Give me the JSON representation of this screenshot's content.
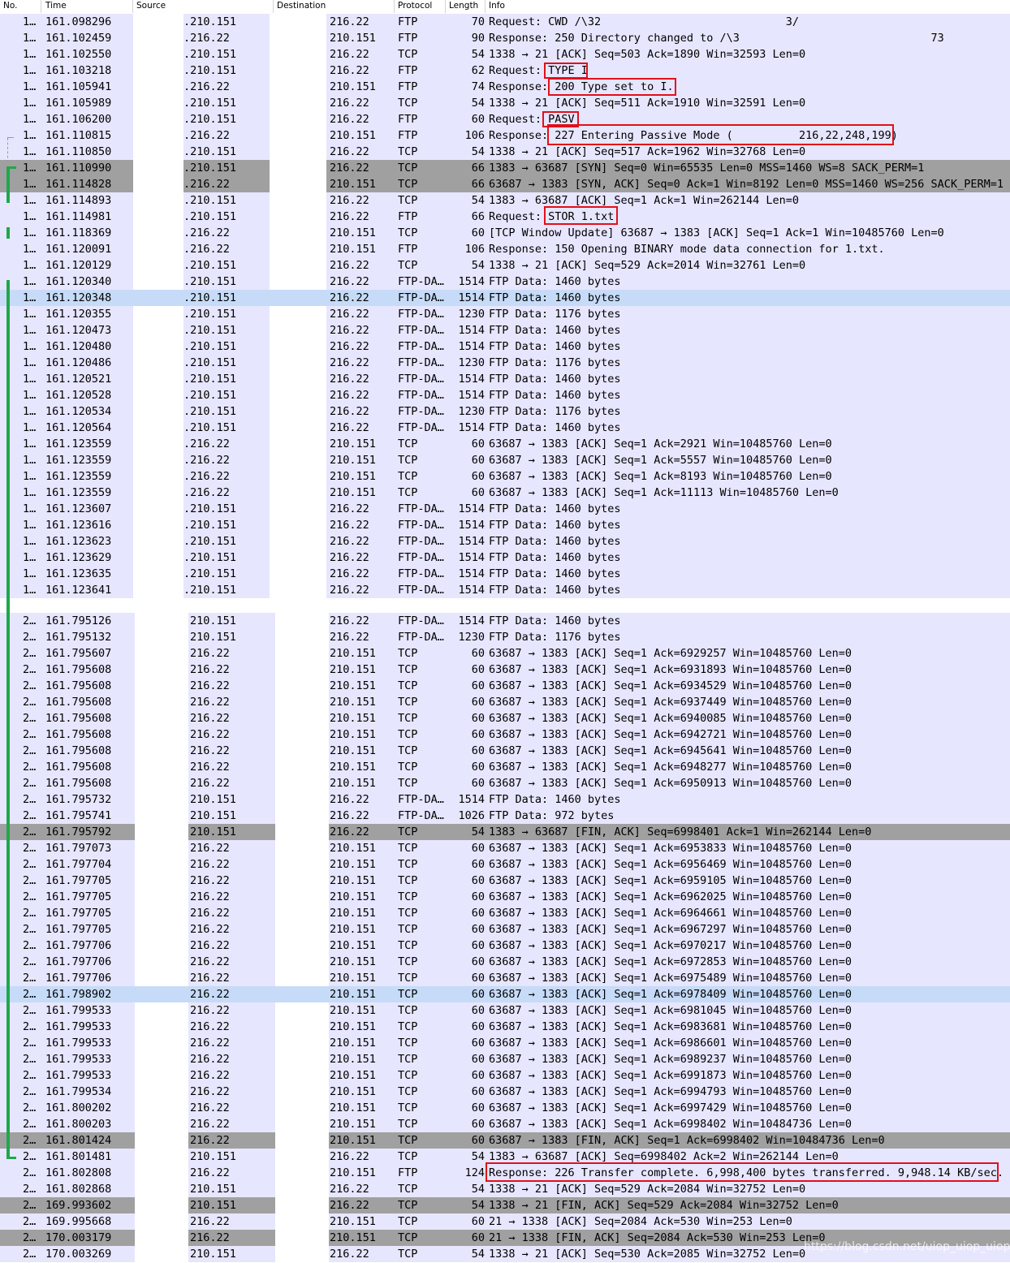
{
  "columns": {
    "no": "No.",
    "time": "Time",
    "source": "Source",
    "destination": "Destination",
    "protocol": "Protocol",
    "length": "Length",
    "info": "Info"
  },
  "colors": {
    "tcp_ftp_bg": "#e7e6ff",
    "selected_bg": "#c6dbf7",
    "fin_bg": "#a0a0a0",
    "white": "#ffffff",
    "highlight_border": "#e0101a",
    "conversation_bracket": "#1fa84a"
  },
  "packets_part1": [
    {
      "no": "1…",
      "time": "161.098296",
      "src": ".210.151",
      "dst": "216.22",
      "proto": "FTP",
      "len": "70",
      "info": "Request: CWD /\\32                            3/",
      "style": "n"
    },
    {
      "no": "1…",
      "time": "161.102459",
      "src": ".216.22",
      "dst": "210.151",
      "proto": "FTP",
      "len": "90",
      "info": "Response: 250 Directory changed to /\\3                             73",
      "style": "n"
    },
    {
      "no": "1…",
      "time": "161.102550",
      "src": ".210.151",
      "dst": "216.22",
      "proto": "TCP",
      "len": "54",
      "info": "1338 → 21 [ACK] Seq=503 Ack=1890 Win=32593 Len=0",
      "style": "n"
    },
    {
      "no": "1…",
      "time": "161.103218",
      "src": ".210.151",
      "dst": "216.22",
      "proto": "FTP",
      "len": "62",
      "info": "Request: TYPE I",
      "style": "n"
    },
    {
      "no": "1…",
      "time": "161.105941",
      "src": ".216.22",
      "dst": "210.151",
      "proto": "FTP",
      "len": "74",
      "info": "Response: 200 Type set to I.",
      "style": "n"
    },
    {
      "no": "1…",
      "time": "161.105989",
      "src": ".210.151",
      "dst": "216.22",
      "proto": "TCP",
      "len": "54",
      "info": "1338 → 21 [ACK] Seq=511 Ack=1910 Win=32591 Len=0",
      "style": "n"
    },
    {
      "no": "1…",
      "time": "161.106200",
      "src": ".210.151",
      "dst": "216.22",
      "proto": "FTP",
      "len": "60",
      "info": "Request: PASV",
      "style": "n"
    },
    {
      "no": "1…",
      "time": "161.110815",
      "src": ".216.22",
      "dst": "210.151",
      "proto": "FTP",
      "len": "106",
      "info": "Response: 227 Entering Passive Mode (          216,22,248,199)",
      "style": "n"
    },
    {
      "no": "1…",
      "time": "161.110850",
      "src": ".210.151",
      "dst": "216.22",
      "proto": "TCP",
      "len": "54",
      "info": "1338 → 21 [ACK] Seq=517 Ack=1962 Win=32768 Len=0",
      "style": "n"
    },
    {
      "no": "1…",
      "time": "161.110990",
      "src": ".210.151",
      "dst": "216.22",
      "proto": "TCP",
      "len": "66",
      "info": "1383 → 63687 [SYN] Seq=0 Win=65535 Len=0 MSS=1460 WS=8 SACK_PERM=1",
      "style": "g"
    },
    {
      "no": "1…",
      "time": "161.114828",
      "src": ".216.22",
      "dst": "210.151",
      "proto": "TCP",
      "len": "66",
      "info": "63687 → 1383 [SYN, ACK] Seq=0 Ack=1 Win=8192 Len=0 MSS=1460 WS=256 SACK_PERM=1",
      "style": "g"
    },
    {
      "no": "1…",
      "time": "161.114893",
      "src": ".210.151",
      "dst": "216.22",
      "proto": "TCP",
      "len": "54",
      "info": "1383 → 63687 [ACK] Seq=1 Ack=1 Win=262144 Len=0",
      "style": "n"
    },
    {
      "no": "1…",
      "time": "161.114981",
      "src": ".210.151",
      "dst": "216.22",
      "proto": "FTP",
      "len": "66",
      "info": "Request: STOR 1.txt",
      "style": "n"
    },
    {
      "no": "1…",
      "time": "161.118369",
      "src": ".216.22",
      "dst": "210.151",
      "proto": "TCP",
      "len": "60",
      "info": "[TCP Window Update] 63687 → 1383 [ACK] Seq=1 Ack=1 Win=10485760 Len=0",
      "style": "n"
    },
    {
      "no": "1…",
      "time": "161.120091",
      "src": ".216.22",
      "dst": "210.151",
      "proto": "FTP",
      "len": "106",
      "info": "Response: 150 Opening BINARY mode data connection for 1.txt.",
      "style": "n"
    },
    {
      "no": "1…",
      "time": "161.120129",
      "src": ".210.151",
      "dst": "216.22",
      "proto": "TCP",
      "len": "54",
      "info": "1338 → 21 [ACK] Seq=529 Ack=2014 Win=32761 Len=0",
      "style": "n"
    },
    {
      "no": "1…",
      "time": "161.120340",
      "src": ".210.151",
      "dst": "216.22",
      "proto": "FTP-DA…",
      "len": "1514",
      "info": "FTP Data: 1460 bytes",
      "style": "n"
    },
    {
      "no": "1…",
      "time": "161.120348",
      "src": ".210.151",
      "dst": "216.22",
      "proto": "FTP-DA…",
      "len": "1514",
      "info": "FTP Data: 1460 bytes",
      "style": "s"
    },
    {
      "no": "1…",
      "time": "161.120355",
      "src": ".210.151",
      "dst": "216.22",
      "proto": "FTP-DA…",
      "len": "1230",
      "info": "FTP Data: 1176 bytes",
      "style": "n"
    },
    {
      "no": "1…",
      "time": "161.120473",
      "src": ".210.151",
      "dst": "216.22",
      "proto": "FTP-DA…",
      "len": "1514",
      "info": "FTP Data: 1460 bytes",
      "style": "n"
    },
    {
      "no": "1…",
      "time": "161.120480",
      "src": ".210.151",
      "dst": "216.22",
      "proto": "FTP-DA…",
      "len": "1514",
      "info": "FTP Data: 1460 bytes",
      "style": "n"
    },
    {
      "no": "1…",
      "time": "161.120486",
      "src": ".210.151",
      "dst": "216.22",
      "proto": "FTP-DA…",
      "len": "1230",
      "info": "FTP Data: 1176 bytes",
      "style": "n"
    },
    {
      "no": "1…",
      "time": "161.120521",
      "src": ".210.151",
      "dst": "216.22",
      "proto": "FTP-DA…",
      "len": "1514",
      "info": "FTP Data: 1460 bytes",
      "style": "n"
    },
    {
      "no": "1…",
      "time": "161.120528",
      "src": ".210.151",
      "dst": "216.22",
      "proto": "FTP-DA…",
      "len": "1514",
      "info": "FTP Data: 1460 bytes",
      "style": "n"
    },
    {
      "no": "1…",
      "time": "161.120534",
      "src": ".210.151",
      "dst": "216.22",
      "proto": "FTP-DA…",
      "len": "1230",
      "info": "FTP Data: 1176 bytes",
      "style": "n"
    },
    {
      "no": "1…",
      "time": "161.120564",
      "src": ".210.151",
      "dst": "216.22",
      "proto": "FTP-DA…",
      "len": "1514",
      "info": "FTP Data: 1460 bytes",
      "style": "n"
    },
    {
      "no": "1…",
      "time": "161.123559",
      "src": ".216.22",
      "dst": "210.151",
      "proto": "TCP",
      "len": "60",
      "info": "63687 → 1383 [ACK] Seq=1 Ack=2921 Win=10485760 Len=0",
      "style": "n"
    },
    {
      "no": "1…",
      "time": "161.123559",
      "src": ".216.22",
      "dst": "210.151",
      "proto": "TCP",
      "len": "60",
      "info": "63687 → 1383 [ACK] Seq=1 Ack=5557 Win=10485760 Len=0",
      "style": "n"
    },
    {
      "no": "1…",
      "time": "161.123559",
      "src": ".216.22",
      "dst": "210.151",
      "proto": "TCP",
      "len": "60",
      "info": "63687 → 1383 [ACK] Seq=1 Ack=8193 Win=10485760 Len=0",
      "style": "n"
    },
    {
      "no": "1…",
      "time": "161.123559",
      "src": ".216.22",
      "dst": "210.151",
      "proto": "TCP",
      "len": "60",
      "info": "63687 → 1383 [ACK] Seq=1 Ack=11113 Win=10485760 Len=0",
      "style": "n"
    },
    {
      "no": "1…",
      "time": "161.123607",
      "src": ".210.151",
      "dst": "216.22",
      "proto": "FTP-DA…",
      "len": "1514",
      "info": "FTP Data: 1460 bytes",
      "style": "n"
    },
    {
      "no": "1…",
      "time": "161.123616",
      "src": ".210.151",
      "dst": "216.22",
      "proto": "FTP-DA…",
      "len": "1514",
      "info": "FTP Data: 1460 bytes",
      "style": "n"
    },
    {
      "no": "1…",
      "time": "161.123623",
      "src": ".210.151",
      "dst": "216.22",
      "proto": "FTP-DA…",
      "len": "1514",
      "info": "FTP Data: 1460 bytes",
      "style": "n"
    },
    {
      "no": "1…",
      "time": "161.123629",
      "src": ".210.151",
      "dst": "216.22",
      "proto": "FTP-DA…",
      "len": "1514",
      "info": "FTP Data: 1460 bytes",
      "style": "n"
    },
    {
      "no": "1…",
      "time": "161.123635",
      "src": ".210.151",
      "dst": "216.22",
      "proto": "FTP-DA…",
      "len": "1514",
      "info": "FTP Data: 1460 bytes",
      "style": "n"
    },
    {
      "no": "1…",
      "time": "161.123641",
      "src": ".210.151",
      "dst": "216.22",
      "proto": "FTP-DA…",
      "len": "1514",
      "info": "FTP Data: 1460 bytes",
      "style": "n"
    }
  ],
  "packets_part2": [
    {
      "no": "2…",
      "time": "161.795126",
      "src": "210.151",
      "dst": "216.22",
      "proto": "FTP-DA…",
      "len": "1514",
      "info": "FTP Data: 1460 bytes",
      "style": "n"
    },
    {
      "no": "2…",
      "time": "161.795132",
      "src": "210.151",
      "dst": "216.22",
      "proto": "FTP-DA…",
      "len": "1230",
      "info": "FTP Data: 1176 bytes",
      "style": "n"
    },
    {
      "no": "2…",
      "time": "161.795607",
      "src": "216.22",
      "dst": "210.151",
      "proto": "TCP",
      "len": "60",
      "info": "63687 → 1383 [ACK] Seq=1 Ack=6929257 Win=10485760 Len=0",
      "style": "n"
    },
    {
      "no": "2…",
      "time": "161.795608",
      "src": "216.22",
      "dst": "210.151",
      "proto": "TCP",
      "len": "60",
      "info": "63687 → 1383 [ACK] Seq=1 Ack=6931893 Win=10485760 Len=0",
      "style": "n"
    },
    {
      "no": "2…",
      "time": "161.795608",
      "src": "216.22",
      "dst": "210.151",
      "proto": "TCP",
      "len": "60",
      "info": "63687 → 1383 [ACK] Seq=1 Ack=6934529 Win=10485760 Len=0",
      "style": "n"
    },
    {
      "no": "2…",
      "time": "161.795608",
      "src": "216.22",
      "dst": "210.151",
      "proto": "TCP",
      "len": "60",
      "info": "63687 → 1383 [ACK] Seq=1 Ack=6937449 Win=10485760 Len=0",
      "style": "n"
    },
    {
      "no": "2…",
      "time": "161.795608",
      "src": "216.22",
      "dst": "210.151",
      "proto": "TCP",
      "len": "60",
      "info": "63687 → 1383 [ACK] Seq=1 Ack=6940085 Win=10485760 Len=0",
      "style": "n"
    },
    {
      "no": "2…",
      "time": "161.795608",
      "src": "216.22",
      "dst": "210.151",
      "proto": "TCP",
      "len": "60",
      "info": "63687 → 1383 [ACK] Seq=1 Ack=6942721 Win=10485760 Len=0",
      "style": "n"
    },
    {
      "no": "2…",
      "time": "161.795608",
      "src": "216.22",
      "dst": "210.151",
      "proto": "TCP",
      "len": "60",
      "info": "63687 → 1383 [ACK] Seq=1 Ack=6945641 Win=10485760 Len=0",
      "style": "n"
    },
    {
      "no": "2…",
      "time": "161.795608",
      "src": "216.22",
      "dst": "210.151",
      "proto": "TCP",
      "len": "60",
      "info": "63687 → 1383 [ACK] Seq=1 Ack=6948277 Win=10485760 Len=0",
      "style": "n"
    },
    {
      "no": "2…",
      "time": "161.795608",
      "src": "216.22",
      "dst": "210.151",
      "proto": "TCP",
      "len": "60",
      "info": "63687 → 1383 [ACK] Seq=1 Ack=6950913 Win=10485760 Len=0",
      "style": "n"
    },
    {
      "no": "2…",
      "time": "161.795732",
      "src": "210.151",
      "dst": "216.22",
      "proto": "FTP-DA…",
      "len": "1514",
      "info": "FTP Data: 1460 bytes",
      "style": "n"
    },
    {
      "no": "2…",
      "time": "161.795741",
      "src": "210.151",
      "dst": "216.22",
      "proto": "FTP-DA…",
      "len": "1026",
      "info": "FTP Data: 972 bytes",
      "style": "n"
    },
    {
      "no": "2…",
      "time": "161.795792",
      "src": "210.151",
      "dst": "216.22",
      "proto": "TCP",
      "len": "54",
      "info": "1383 → 63687 [FIN, ACK] Seq=6998401 Ack=1 Win=262144 Len=0",
      "style": "g"
    },
    {
      "no": "2…",
      "time": "161.797073",
      "src": "216.22",
      "dst": "210.151",
      "proto": "TCP",
      "len": "60",
      "info": "63687 → 1383 [ACK] Seq=1 Ack=6953833 Win=10485760 Len=0",
      "style": "n"
    },
    {
      "no": "2…",
      "time": "161.797704",
      "src": "216.22",
      "dst": "210.151",
      "proto": "TCP",
      "len": "60",
      "info": "63687 → 1383 [ACK] Seq=1 Ack=6956469 Win=10485760 Len=0",
      "style": "n"
    },
    {
      "no": "2…",
      "time": "161.797705",
      "src": "216.22",
      "dst": "210.151",
      "proto": "TCP",
      "len": "60",
      "info": "63687 → 1383 [ACK] Seq=1 Ack=6959105 Win=10485760 Len=0",
      "style": "n"
    },
    {
      "no": "2…",
      "time": "161.797705",
      "src": "216.22",
      "dst": "210.151",
      "proto": "TCP",
      "len": "60",
      "info": "63687 → 1383 [ACK] Seq=1 Ack=6962025 Win=10485760 Len=0",
      "style": "n"
    },
    {
      "no": "2…",
      "time": "161.797705",
      "src": "216.22",
      "dst": "210.151",
      "proto": "TCP",
      "len": "60",
      "info": "63687 → 1383 [ACK] Seq=1 Ack=6964661 Win=10485760 Len=0",
      "style": "n"
    },
    {
      "no": "2…",
      "time": "161.797705",
      "src": "216.22",
      "dst": "210.151",
      "proto": "TCP",
      "len": "60",
      "info": "63687 → 1383 [ACK] Seq=1 Ack=6967297 Win=10485760 Len=0",
      "style": "n"
    },
    {
      "no": "2…",
      "time": "161.797706",
      "src": "216.22",
      "dst": "210.151",
      "proto": "TCP",
      "len": "60",
      "info": "63687 → 1383 [ACK] Seq=1 Ack=6970217 Win=10485760 Len=0",
      "style": "n"
    },
    {
      "no": "2…",
      "time": "161.797706",
      "src": "216.22",
      "dst": "210.151",
      "proto": "TCP",
      "len": "60",
      "info": "63687 → 1383 [ACK] Seq=1 Ack=6972853 Win=10485760 Len=0",
      "style": "n"
    },
    {
      "no": "2…",
      "time": "161.797706",
      "src": "216.22",
      "dst": "210.151",
      "proto": "TCP",
      "len": "60",
      "info": "63687 → 1383 [ACK] Seq=1 Ack=6975489 Win=10485760 Len=0",
      "style": "n"
    },
    {
      "no": "2…",
      "time": "161.798902",
      "src": "216.22",
      "dst": "210.151",
      "proto": "TCP",
      "len": "60",
      "info": "63687 → 1383 [ACK] Seq=1 Ack=6978409 Win=10485760 Len=0",
      "style": "s"
    },
    {
      "no": "2…",
      "time": "161.799533",
      "src": "216.22",
      "dst": "210.151",
      "proto": "TCP",
      "len": "60",
      "info": "63687 → 1383 [ACK] Seq=1 Ack=6981045 Win=10485760 Len=0",
      "style": "n"
    },
    {
      "no": "2…",
      "time": "161.799533",
      "src": "216.22",
      "dst": "210.151",
      "proto": "TCP",
      "len": "60",
      "info": "63687 → 1383 [ACK] Seq=1 Ack=6983681 Win=10485760 Len=0",
      "style": "n"
    },
    {
      "no": "2…",
      "time": "161.799533",
      "src": "216.22",
      "dst": "210.151",
      "proto": "TCP",
      "len": "60",
      "info": "63687 → 1383 [ACK] Seq=1 Ack=6986601 Win=10485760 Len=0",
      "style": "n"
    },
    {
      "no": "2…",
      "time": "161.799533",
      "src": "216.22",
      "dst": "210.151",
      "proto": "TCP",
      "len": "60",
      "info": "63687 → 1383 [ACK] Seq=1 Ack=6989237 Win=10485760 Len=0",
      "style": "n"
    },
    {
      "no": "2…",
      "time": "161.799533",
      "src": "216.22",
      "dst": "210.151",
      "proto": "TCP",
      "len": "60",
      "info": "63687 → 1383 [ACK] Seq=1 Ack=6991873 Win=10485760 Len=0",
      "style": "n"
    },
    {
      "no": "2…",
      "time": "161.799534",
      "src": "216.22",
      "dst": "210.151",
      "proto": "TCP",
      "len": "60",
      "info": "63687 → 1383 [ACK] Seq=1 Ack=6994793 Win=10485760 Len=0",
      "style": "n"
    },
    {
      "no": "2…",
      "time": "161.800202",
      "src": "216.22",
      "dst": "210.151",
      "proto": "TCP",
      "len": "60",
      "info": "63687 → 1383 [ACK] Seq=1 Ack=6997429 Win=10485760 Len=0",
      "style": "n"
    },
    {
      "no": "2…",
      "time": "161.800203",
      "src": "216.22",
      "dst": "210.151",
      "proto": "TCP",
      "len": "60",
      "info": "63687 → 1383 [ACK] Seq=1 Ack=6998402 Win=10484736 Len=0",
      "style": "n"
    },
    {
      "no": "2…",
      "time": "161.801424",
      "src": "216.22",
      "dst": "210.151",
      "proto": "TCP",
      "len": "60",
      "info": "63687 → 1383 [FIN, ACK] Seq=1 Ack=6998402 Win=10484736 Len=0",
      "style": "g"
    },
    {
      "no": "2…",
      "time": "161.801481",
      "src": "210.151",
      "dst": "216.22",
      "proto": "TCP",
      "len": "54",
      "info": "1383 → 63687 [ACK] Seq=6998402 Ack=2 Win=262144 Len=0",
      "style": "n"
    },
    {
      "no": "2…",
      "time": "161.802808",
      "src": "216.22",
      "dst": "210.151",
      "proto": "FTP",
      "len": "124",
      "info": "Response: 226 Transfer complete. 6,998,400 bytes transferred. 9,948.14 KB/sec.",
      "style": "n"
    },
    {
      "no": "2…",
      "time": "161.802868",
      "src": "210.151",
      "dst": "216.22",
      "proto": "TCP",
      "len": "54",
      "info": "1338 → 21 [ACK] Seq=529 Ack=2084 Win=32752 Len=0",
      "style": "n"
    },
    {
      "no": "2…",
      "time": "169.993602",
      "src": "210.151",
      "dst": "216.22",
      "proto": "TCP",
      "len": "54",
      "info": "1338 → 21 [FIN, ACK] Seq=529 Ack=2084 Win=32752 Len=0",
      "style": "g"
    },
    {
      "no": "2…",
      "time": "169.995668",
      "src": "216.22",
      "dst": "210.151",
      "proto": "TCP",
      "len": "60",
      "info": "21 → 1338 [ACK] Seq=2084 Ack=530 Win=253 Len=0",
      "style": "n"
    },
    {
      "no": "2…",
      "time": "170.003179",
      "src": "216.22",
      "dst": "210.151",
      "proto": "TCP",
      "len": "60",
      "info": "21 → 1338 [FIN, ACK] Seq=2084 Ack=530 Win=253 Len=0",
      "style": "g"
    },
    {
      "no": "2…",
      "time": "170.003269",
      "src": "210.151",
      "dst": "216.22",
      "proto": "TCP",
      "len": "54",
      "info": "1338 → 21 [ACK] Seq=530 Ack=2085 Win=32752 Len=0",
      "style": "n"
    }
  ],
  "watermark": "https://blog.csdn.net/uiop_uiop_uiop"
}
